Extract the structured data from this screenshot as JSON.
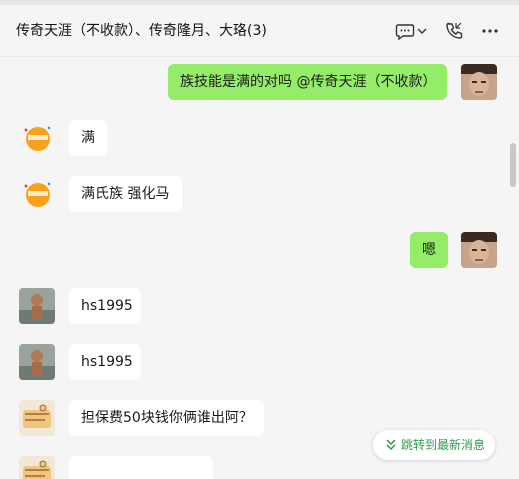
{
  "header": {
    "title": "传奇天涯（不收款）、传奇隆月、大珞(3)"
  },
  "messages": [
    {
      "side": "self",
      "text": "族技能是满的对吗 @传奇天涯（不收款）"
    },
    {
      "side": "other",
      "text": "满"
    },
    {
      "side": "other",
      "text": "满氏族 强化马"
    },
    {
      "side": "self",
      "text": "嗯"
    },
    {
      "side": "other",
      "text": "hs1995"
    },
    {
      "side": "other",
      "text": "hs1995"
    },
    {
      "side": "other",
      "text": "担保费50块钱你俩谁出阿？"
    },
    {
      "side": "other",
      "text": ""
    }
  ],
  "jump_button": {
    "label": "跳转到最新消息"
  },
  "icons": {
    "chat": "chat-bubble-icon",
    "dropdown": "chevron-down-icon",
    "call": "phone-icon",
    "more": "more-icon",
    "jump": "double-chevron-down-icon"
  },
  "colors": {
    "self_bubble": "#95ec69",
    "other_bubble": "#ffffff",
    "background": "#f5f5f5",
    "accent": "#2a9d49"
  }
}
